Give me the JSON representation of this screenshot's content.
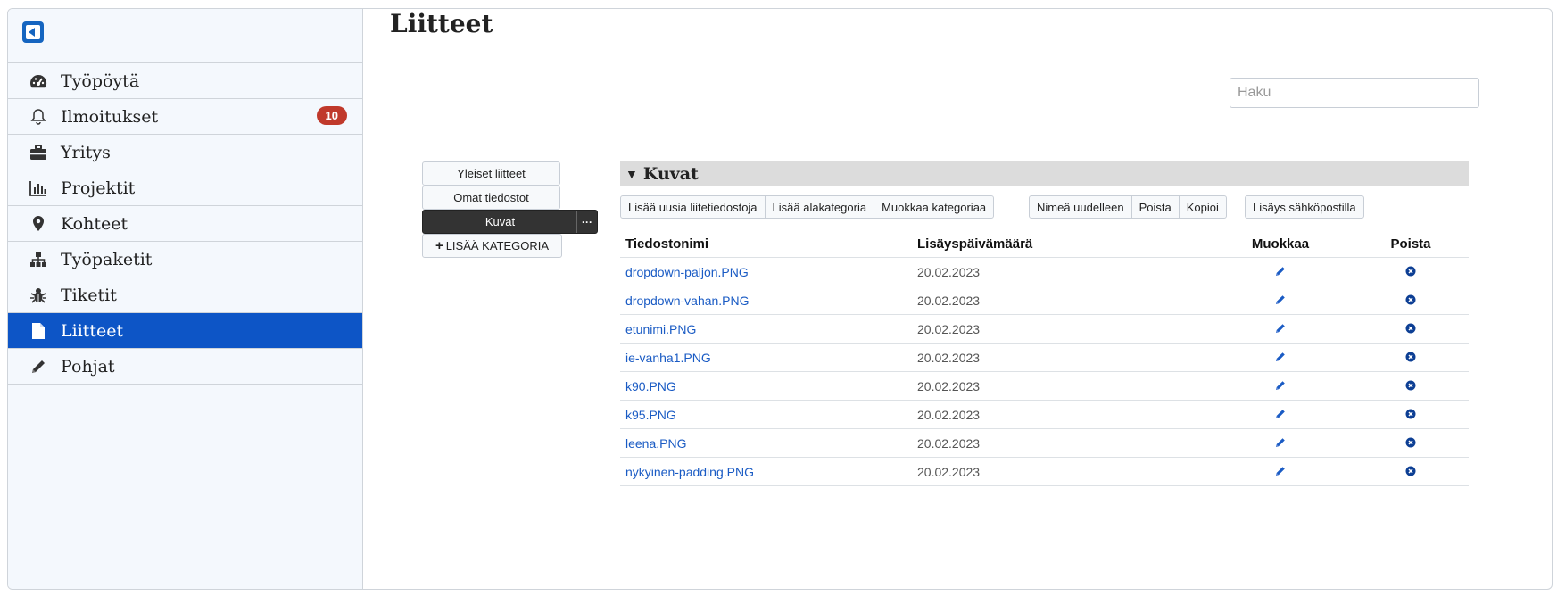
{
  "sidebar": {
    "items": [
      {
        "label": "Työpöytä",
        "icon": "dashboard-icon"
      },
      {
        "label": "Ilmoitukset",
        "icon": "bell-icon",
        "badge": "10"
      },
      {
        "label": "Yritys",
        "icon": "briefcase-icon"
      },
      {
        "label": "Projektit",
        "icon": "bar-chart-icon"
      },
      {
        "label": "Kohteet",
        "icon": "map-pin-icon"
      },
      {
        "label": "Työpaketit",
        "icon": "sitemap-icon"
      },
      {
        "label": "Tiketit",
        "icon": "bug-icon"
      },
      {
        "label": "Liitteet",
        "icon": "file-icon",
        "active": true
      },
      {
        "label": "Pohjat",
        "icon": "pencil-icon"
      }
    ]
  },
  "page": {
    "title": "Liitteet"
  },
  "search": {
    "placeholder": "Haku"
  },
  "categories": {
    "items": [
      "Yleiset liitteet",
      "Omat tiedostot",
      "Kuvat"
    ],
    "active_dots": "···",
    "add_label": "LISÄÄ KATEGORIA"
  },
  "section": {
    "title": "Kuvat"
  },
  "toolbar": {
    "group1": [
      "Lisää uusia liitetiedostoja",
      "Lisää alakategoria",
      "Muokkaa kategoriaa"
    ],
    "group2": [
      "Nimeä uudelleen",
      "Poista",
      "Kopioi"
    ],
    "group3": [
      "Lisäys sähköpostilla"
    ]
  },
  "table": {
    "headers": [
      "Tiedostonimi",
      "Lisäyspäivämäärä",
      "Muokkaa",
      "Poista"
    ],
    "rows": [
      {
        "name": "dropdown-paljon.PNG",
        "date": "20.02.2023"
      },
      {
        "name": "dropdown-vahan.PNG",
        "date": "20.02.2023"
      },
      {
        "name": "etunimi.PNG",
        "date": "20.02.2023"
      },
      {
        "name": "ie-vanha1.PNG",
        "date": "20.02.2023"
      },
      {
        "name": "k90.PNG",
        "date": "20.02.2023"
      },
      {
        "name": "k95.PNG",
        "date": "20.02.2023"
      },
      {
        "name": "leena.PNG",
        "date": "20.02.2023"
      },
      {
        "name": "nykyinen-padding.PNG",
        "date": "20.02.2023"
      }
    ]
  },
  "colors": {
    "accent": "#0d55c6",
    "badge": "#c0392b",
    "link": "#1a5bc4"
  }
}
